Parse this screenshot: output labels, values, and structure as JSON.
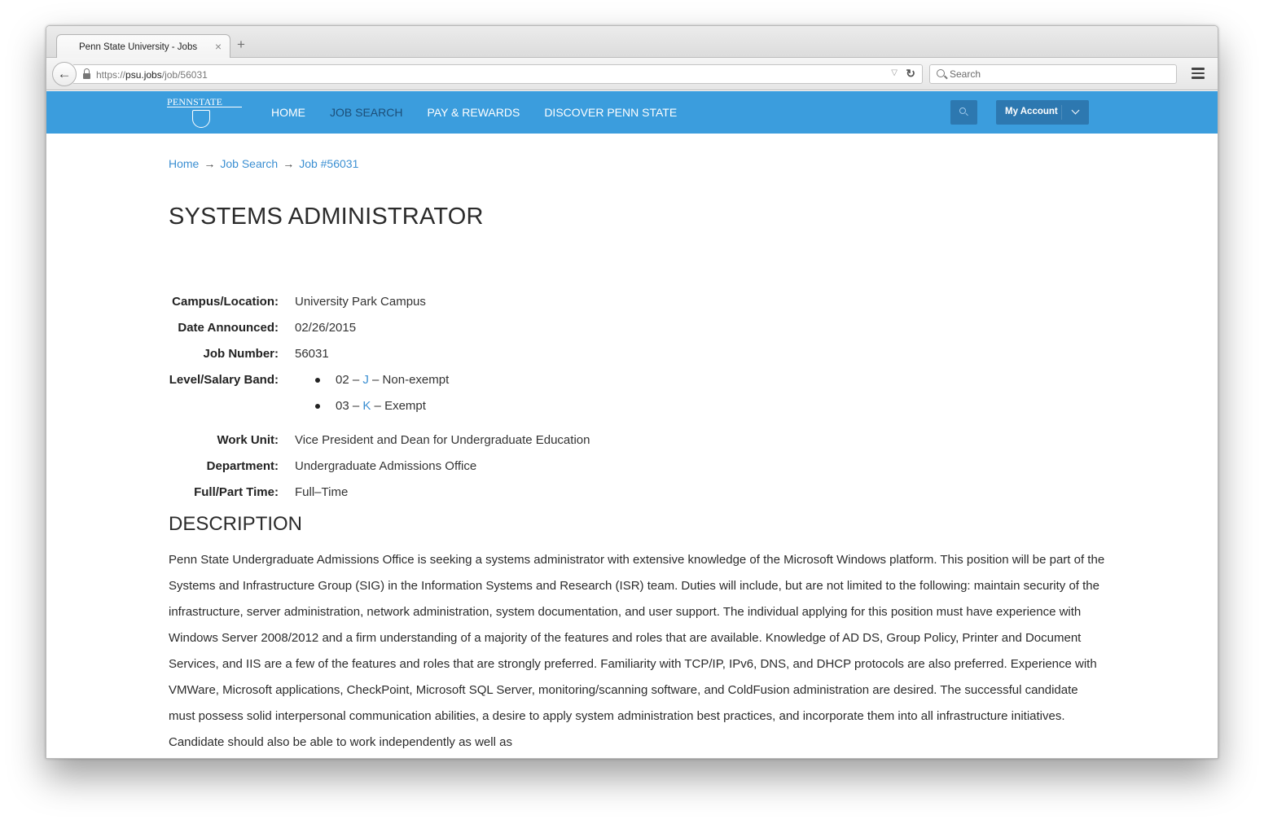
{
  "browser": {
    "tab_title": "Penn State University - Jobs",
    "tab_close": "×",
    "new_tab": "+",
    "url_prefix": "https://",
    "url_host": "psu.jobs",
    "url_path": "/job/56031",
    "search_placeholder": "Search",
    "back_glyph": "🡐",
    "reload_glyph": "↻",
    "dropdown_glyph": "▽"
  },
  "header": {
    "logo_text": "PENNSTATE",
    "nav": [
      {
        "label": "HOME",
        "active": false
      },
      {
        "label": "JOB SEARCH",
        "active": true
      },
      {
        "label": "PAY & REWARDS",
        "active": false
      },
      {
        "label": "DISCOVER PENN STATE",
        "active": false
      }
    ],
    "account_label": "My Account",
    "colors": {
      "bar": "#3b9ddd",
      "button": "#2d78b0",
      "active_nav": "#1c4e78",
      "link": "#3b8fd2"
    }
  },
  "breadcrumb": {
    "items": [
      "Home",
      "Job Search",
      "Job #56031"
    ],
    "separator": "→"
  },
  "job": {
    "title": "SYSTEMS ADMINISTRATOR",
    "campus_label": "Campus/Location:",
    "campus": "University Park Campus",
    "date_label": "Date Announced:",
    "date": "02/26/2015",
    "number_label": "Job Number:",
    "number": "56031",
    "band_label": "Level/Salary Band:",
    "bands": [
      {
        "level": "02 – ",
        "grade": "J",
        "type": " – Non-exempt"
      },
      {
        "level": "03 – ",
        "grade": "K",
        "type": " – Exempt"
      }
    ],
    "unit_label": "Work Unit:",
    "unit": "Vice President and Dean for Undergraduate Education",
    "dept_label": "Department:",
    "dept": "Undergraduate Admissions Office",
    "time_label": "Full/Part Time:",
    "time": "Full–Time"
  },
  "description": {
    "heading": "DESCRIPTION",
    "text": "Penn State Undergraduate Admissions Office is seeking a systems administrator with extensive knowledge of the Microsoft Windows platform. This position will be part of the Systems and Infrastructure Group (SIG) in the Information Systems and Research (ISR) team. Duties will include, but are not limited to the following: maintain security of the infrastructure, server administration, network administration, system documentation, and user support. The individual applying for this position must have experience with Windows Server 2008/2012 and a firm understanding of a majority of the features and roles that are available. Knowledge of AD DS, Group Policy, Printer and Document Services, and IIS are a few of the features and roles that are strongly preferred. Familiarity with TCP/IP, IPv6, DNS, and DHCP protocols are also preferred. Experience with VMWare, Microsoft applications, CheckPoint, Microsoft SQL Server, monitoring/scanning software, and ColdFusion administration are desired. The successful candidate must possess solid interpersonal communication abilities, a desire to apply system administration best practices, and incorporate them into all infrastructure initiatives. Candidate should also be able to work independently as well as"
  }
}
